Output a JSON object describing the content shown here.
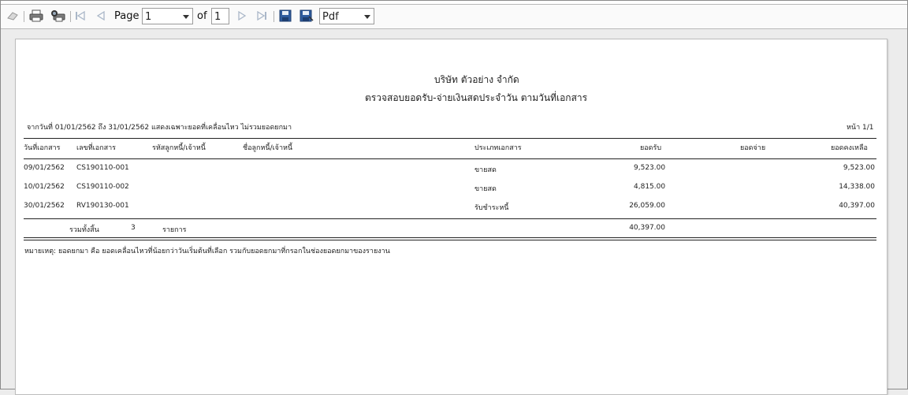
{
  "toolbar": {
    "page_label": "Page",
    "page_value": "1",
    "of_label": "of",
    "total_pages": "1",
    "export_format": "Pdf"
  },
  "report": {
    "company": "บริษัท ตัวอย่าง จำกัด",
    "title": "ตรวจสอบยอดรับ-จ่ายเงินสดประจำวัน ตามวันที่เอกสาร",
    "filter_text": "จากวันที่ 01/01/2562 ถึง 31/01/2562 แสดงเฉพาะยอดที่เคลื่อนไหว ไม่รวมยอดยกมา",
    "page_text": "หน้า 1/1",
    "columns": {
      "doc_date": "วันที่เอกสาร",
      "doc_no": "เลขที่เอกสาร",
      "party_code": "รหัสลูกหนี้/เจ้าหนี้",
      "party_name": "ชื่อลูกหนี้/เจ้าหนี้",
      "doc_type": "ประเภทเอกสาร",
      "receipt": "ยอดรับ",
      "payment": "ยอดจ่าย",
      "balance": "ยอดคงเหลือ"
    },
    "rows": [
      {
        "doc_date": "09/01/2562",
        "doc_no": "CS190110-001",
        "doc_type": "ขายสด",
        "receipt": "9,523.00",
        "payment": "",
        "balance": "9,523.00"
      },
      {
        "doc_date": "10/01/2562",
        "doc_no": "CS190110-002",
        "doc_type": "ขายสด",
        "receipt": "4,815.00",
        "payment": "",
        "balance": "14,338.00"
      },
      {
        "doc_date": "30/01/2562",
        "doc_no": "RV190130-001",
        "doc_type": "รับชำระหนี้",
        "receipt": "26,059.00",
        "payment": "",
        "balance": "40,397.00"
      }
    ],
    "total": {
      "label": "รวมทั้งสิ้น",
      "count": "3",
      "unit": "รายการ",
      "receipt": "40,397.00"
    },
    "footnote": "หมายเหตุ: ยอดยกมา คือ ยอดเคลื่อนไหวที่น้อยกว่าวันเริ่มต้นที่เลือก รวมกับยอดยกมาที่กรอกในช่องยอดยกมาของรายงาน"
  }
}
